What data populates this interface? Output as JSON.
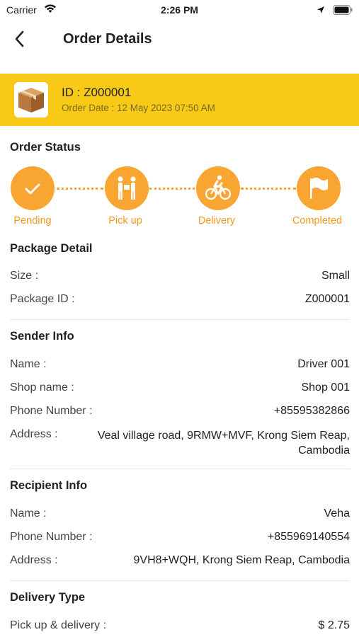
{
  "status_bar": {
    "carrier": "Carrier",
    "time": "2:26 PM"
  },
  "nav": {
    "title": "Order Details"
  },
  "order": {
    "id_text": "ID  : Z000001",
    "date_text": "Order Date  : 12 May 2023  07:50 AM"
  },
  "order_status": {
    "title": "Order Status",
    "steps": [
      {
        "label": "Pending",
        "icon": "check-icon"
      },
      {
        "label": "Pick up",
        "icon": "handover-icon"
      },
      {
        "label": "Delivery",
        "icon": "bicycle-icon"
      },
      {
        "label": "Completed",
        "icon": "flag-icon"
      }
    ]
  },
  "package": {
    "title": "Package Detail",
    "size_label": "Size :",
    "size_value": "Small",
    "id_label": "Package ID :",
    "id_value": "Z000001"
  },
  "sender": {
    "title": "Sender Info",
    "name_label": "Name :",
    "name_value": "Driver 001",
    "shop_label": "Shop name :",
    "shop_value": "Shop 001",
    "phone_label": "Phone Number :",
    "phone_value": "+85595382866",
    "address_label": "Address :",
    "address_value": "Veal village road, 9RMW+MVF, Krong Siem Reap, Cambodia"
  },
  "recipient": {
    "title": "Recipient Info",
    "name_label": "Name :",
    "name_value": "Veha",
    "phone_label": "Phone Number :",
    "phone_value": "+855969140554",
    "address_label": "Address :",
    "address_value": "9VH8+WQH, Krong Siem Reap, Cambodia"
  },
  "delivery": {
    "title": "Delivery Type",
    "type_label": "Pick up & delivery :",
    "price_value": "$ 2.75"
  },
  "colors": {
    "banner": "#f8c916",
    "step": "#f8a631",
    "step_label": "#f39a1e"
  }
}
